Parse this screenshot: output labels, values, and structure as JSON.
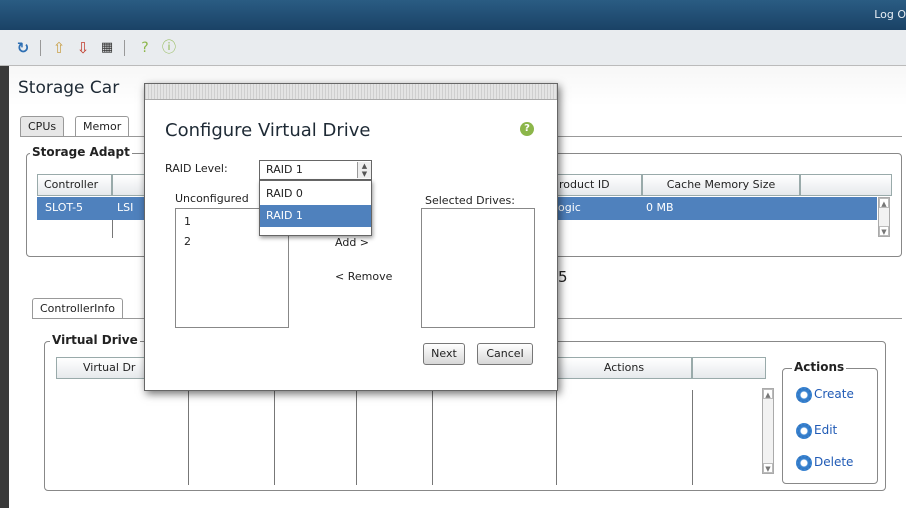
{
  "header": {
    "logout_label": "Log O"
  },
  "toolbar": {
    "icons": [
      "refresh-icon",
      "upload-icon",
      "download-icon",
      "grid-icon",
      "help-icon",
      "info-icon"
    ]
  },
  "page": {
    "title": "Storage Car"
  },
  "top_tabs": [
    "CPUs",
    "Memor"
  ],
  "storage_adapters": {
    "legend": "Storage Adapt",
    "columns": [
      "Controller",
      "",
      "roduct ID",
      "Cache Memory Size",
      ""
    ],
    "row": {
      "controller": "SLOT-5",
      "vendor": "LSI",
      "product": "ogic",
      "cache": "0 MB"
    }
  },
  "partial_text_5": "5",
  "lower_tabs": [
    "ControllerInfo"
  ],
  "virtual_drives": {
    "legend": "Virtual Drive",
    "columns": [
      "Virtual Dr",
      "Actions",
      ""
    ]
  },
  "actions": {
    "legend": "Actions",
    "items": [
      {
        "label": "Create",
        "icon": "gear-icon"
      },
      {
        "label": "Edit",
        "icon": "gear-icon"
      },
      {
        "label": "Delete",
        "icon": "gear-icon"
      }
    ]
  },
  "modal": {
    "title": "Configure Virtual Drive",
    "raid_label": "RAID Level:",
    "raid_selected": "RAID 1",
    "raid_options": [
      "RAID 0",
      "RAID 1"
    ],
    "unconfigured_label": "Unconfigured",
    "unconfigured_drives": [
      "1",
      "2"
    ],
    "add_label": "Add >",
    "remove_label": "< Remove",
    "selected_label": "Selected Drives:",
    "next_label": "Next",
    "cancel_label": "Cancel"
  },
  "colors": {
    "accent": "#4f81bd",
    "topbar": "#2a5c83",
    "link": "#1f5ab5"
  }
}
